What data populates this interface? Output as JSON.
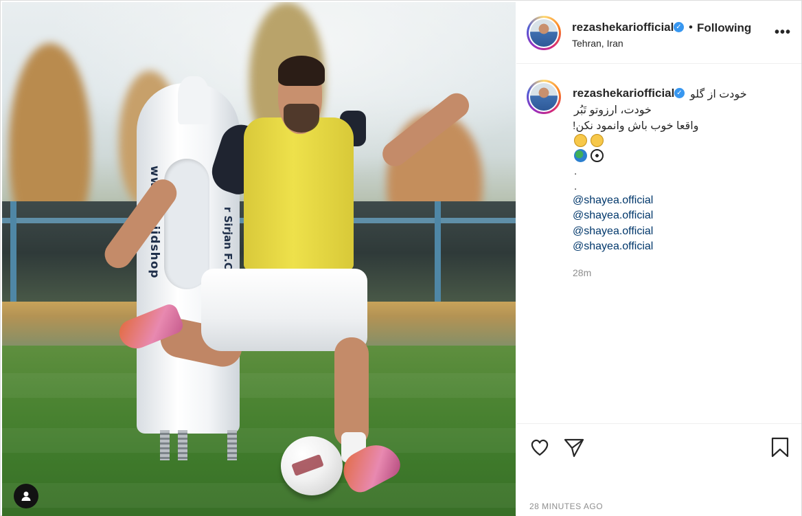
{
  "photo": {
    "mannequin_text_1": "www.majidshop",
    "mannequin_text_2": "r Sirjan F.C.",
    "ball_text": "RUNSTAR"
  },
  "header": {
    "username": "rezashekariofficial",
    "verified_mark": "✓",
    "separator": "•",
    "follow_status": "Following",
    "location": "Tehran, Iran",
    "more_label": "•••"
  },
  "caption": {
    "username": "rezashekariofficial",
    "verified_mark": "✓",
    "line1": "خودت از گلو",
    "line2": "خودت، ارزوتو تَبُر",
    "line3": "واقعا خوب باش وانمود نکن!",
    "dot1": ".",
    "dot2": ".",
    "mentions": [
      "@shayea.official",
      "@shayea.official",
      "@shayea.official",
      "@shayea.official"
    ],
    "relative_time": "28m"
  },
  "footer": {
    "timestamp": "28 MINUTES AGO"
  },
  "icons": {
    "like": "heart-icon",
    "share": "share-icon",
    "save": "bookmark-icon",
    "tag": "user-tag-icon",
    "more": "more-options-icon"
  },
  "colors": {
    "verified": "#3897f0",
    "mention": "#00376b",
    "muted": "#8e8e8e"
  }
}
